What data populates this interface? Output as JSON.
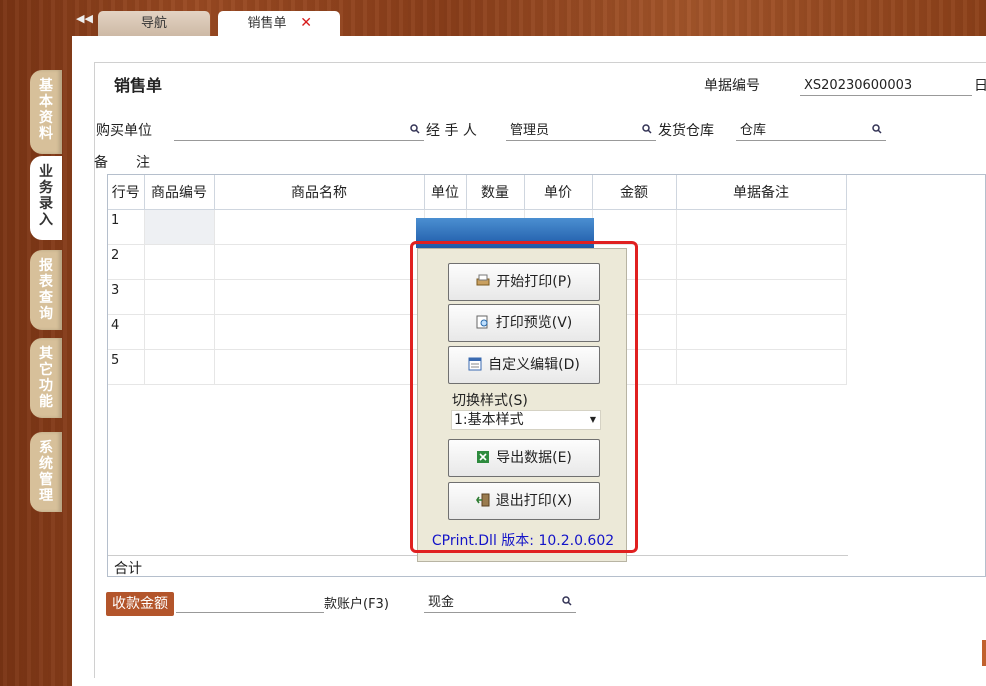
{
  "tabs": {
    "nav_label": "导航",
    "active_label": "销售单",
    "close_glyph": "✕"
  },
  "sidebar": [
    {
      "label": "基本资料",
      "active": false
    },
    {
      "label": "业务录入",
      "active": true
    },
    {
      "label": "报表查询",
      "active": false
    },
    {
      "label": "其它功能",
      "active": false
    },
    {
      "label": "系统管理",
      "active": false
    }
  ],
  "form": {
    "title": "销售单",
    "doc_no_label": "单据编号",
    "doc_no_value": "XS20230600003",
    "date_label_partial": "日",
    "buyer_label": "购买单位",
    "buyer_value": "",
    "handler_label": "经 手 人",
    "handler_value": "管理员",
    "warehouse_label": "发货仓库",
    "warehouse_value": "仓库",
    "note_label": "备　　注"
  },
  "grid": {
    "headers": [
      "行号",
      "商品编号",
      "商品名称",
      "单位",
      "数量",
      "单价",
      "金额",
      "单据备注"
    ],
    "rows": [
      "1",
      "2",
      "3",
      "4",
      "5"
    ],
    "sum_label": "合计"
  },
  "bottom": {
    "fee_button": "收款金额",
    "account_label": "款账户(F3)",
    "account_value": "现金"
  },
  "print_dialog": {
    "start_print": "开始打印(P)",
    "preview": "打印预览(V)",
    "custom_edit": "自定义编辑(D)",
    "style_label": "切换样式(S)",
    "style_value": "1:基本样式",
    "export": "导出数据(E)",
    "exit": "退出打印(X)",
    "version": "CPrint.Dll 版本: 10.2.0.602"
  }
}
